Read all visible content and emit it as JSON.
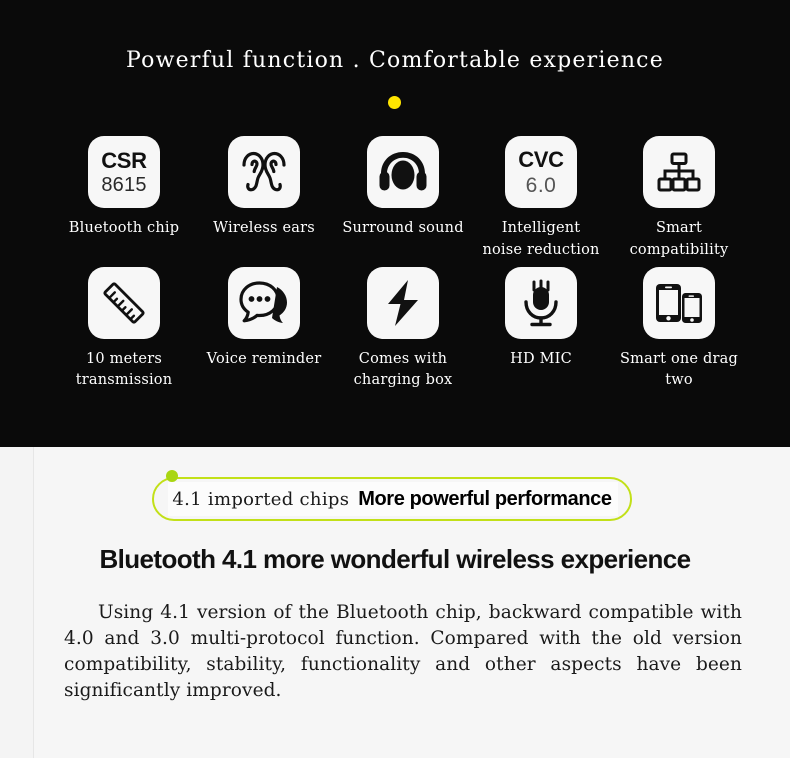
{
  "hero": {
    "title": "Powerful function . Comfortable experience",
    "accent_dot_color": "#ffe500",
    "background_color": "#0a0a0a",
    "features": [
      {
        "icon": "csr-chip-icon",
        "tile_big_text": "CSR",
        "tile_small_text": "8615",
        "label": "Bluetooth chip"
      },
      {
        "icon": "wireless-ears-icon",
        "label": "Wireless ears"
      },
      {
        "icon": "headphones-icon",
        "label": "Surround sound"
      },
      {
        "icon": "cvc-noise-icon",
        "tile_big_text": "CVC",
        "tile_thin_text": "6.0",
        "label": "Intelligent\nnoise reduction"
      },
      {
        "icon": "sitemap-icon",
        "label": "Smart compatibility"
      },
      {
        "icon": "ruler-icon",
        "label": "10 meters\ntransmission"
      },
      {
        "icon": "speech-bubble-icon",
        "label": "Voice reminder"
      },
      {
        "icon": "lightning-bolt-icon",
        "label": "Comes with\ncharging box"
      },
      {
        "icon": "microphone-icon",
        "label": "HD MIC"
      },
      {
        "icon": "two-phones-icon",
        "label": "Smart one drag two"
      }
    ]
  },
  "lower": {
    "pill_accent_color": "#a9d612",
    "pill_serif_text": "4.1 imported chips",
    "pill_bold_text": "More powerful performance",
    "subheading": "Bluetooth 4.1 more wonderful wireless experience",
    "paragraph": "Using 4.1 version of the Bluetooth chip, backward compatible with 4.0 and 3.0 multi-protocol function. Compared with the old version compatibility, stability, functionality and other aspects have been significantly improved."
  }
}
